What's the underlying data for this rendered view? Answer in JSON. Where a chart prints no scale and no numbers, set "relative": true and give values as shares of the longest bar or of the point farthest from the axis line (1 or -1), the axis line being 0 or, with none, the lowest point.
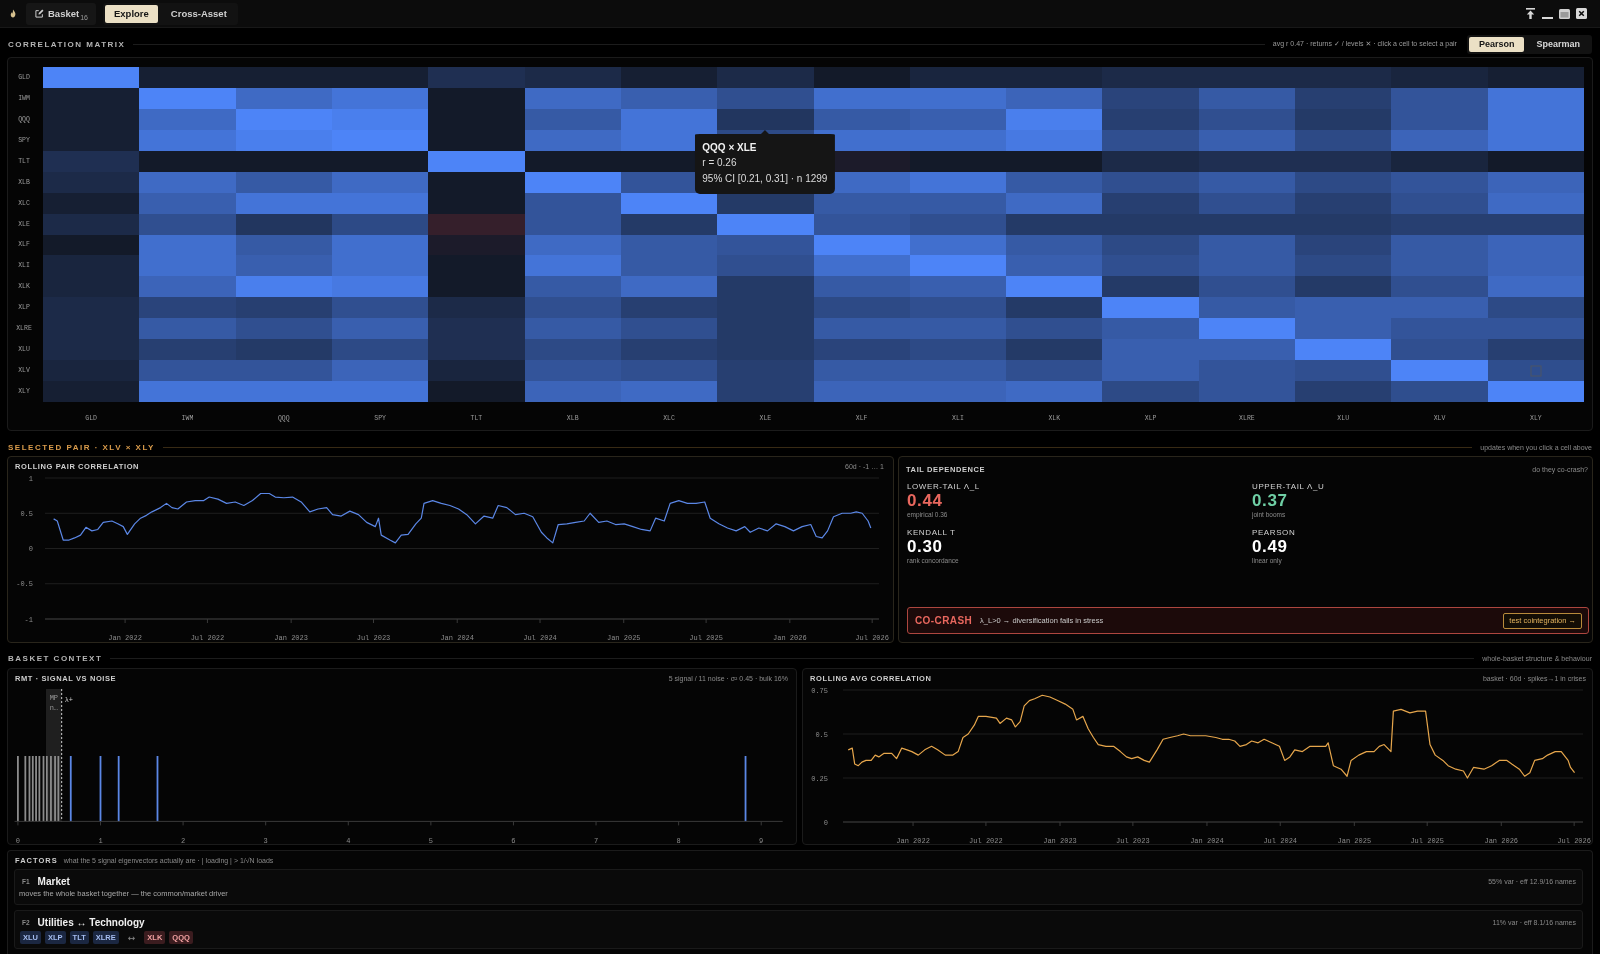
{
  "app_bar": {
    "basket_button": {
      "label": "Basket",
      "count": "16"
    },
    "tabs": [
      {
        "label": "Explore",
        "selected": true
      },
      {
        "label": "Cross-Asset",
        "selected": false
      }
    ]
  },
  "correlation": {
    "title": "CORRELATION MATRIX",
    "summary": "avg r 0.47 · returns ✓ / levels ✕ · click a cell to select a pair",
    "methods": [
      {
        "label": "Pearson",
        "selected": true
      },
      {
        "label": "Spearman",
        "selected": false
      }
    ],
    "matrix": {
      "row_labels": [
        "GLD",
        "IWM",
        "QQQ",
        "SPY",
        "TLT",
        "XLB",
        "XLC",
        "XLE",
        "XLF",
        "XLI",
        "XLK",
        "XLP",
        "XLRE",
        "XLU",
        "XLV",
        "XLY"
      ],
      "column_labels": [
        "GLD",
        "IWM",
        "QQQ",
        "SPY",
        "TLT",
        "XLB",
        "XLC",
        "XLE",
        "XLF",
        "XLI",
        "XLK",
        "XLP",
        "XLRE",
        "XLU",
        "XLV",
        "XLY"
      ]
    },
    "tooltip": {
      "title": "QQQ × XLE",
      "lines": [
        "r = 0.26",
        "95% CI [0.21, 0.31] · n 1299"
      ]
    }
  },
  "selected_pair": {
    "title": "SELECTED PAIR · XLV × XLY",
    "note": "updates when you click a cell above",
    "rolling": {
      "title": "ROLLING PAIR CORRELATION",
      "note": "60d · -1 … 1",
      "chart_data": {
        "type": "line",
        "x": [
          "2021-07-28",
          "2021-08-05",
          "2021-08-18",
          "2021-08-31",
          "2021-09-12",
          "2021-09-25",
          "2021-10-07",
          "2021-10-20",
          "2021-11-02",
          "2021-11-14",
          "2021-12-03",
          "2021-12-16",
          "2021-12-28",
          "2022-01-06",
          "2022-01-22",
          "2022-02-04",
          "2022-02-17",
          "2022-03-01",
          "2022-03-20",
          "2022-04-02",
          "2022-04-14",
          "2022-04-27",
          "2022-05-16",
          "2022-06-04",
          "2022-06-23",
          "2022-07-05",
          "2022-07-24",
          "2022-08-12",
          "2022-08-31",
          "2022-09-19",
          "2022-10-08",
          "2022-10-26",
          "2022-11-14",
          "2022-11-27",
          "2022-12-16",
          "2023-01-04",
          "2023-01-23",
          "2023-02-11",
          "2023-03-01",
          "2023-03-20",
          "2023-04-02",
          "2023-04-21",
          "2023-05-10",
          "2023-05-29",
          "2023-06-16",
          "2023-07-05",
          "2023-07-12",
          "2023-07-18",
          "2023-08-06",
          "2023-08-18",
          "2023-08-31",
          "2023-09-15",
          "2023-10-02",
          "2023-10-14",
          "2023-10-20",
          "2023-11-08",
          "2023-11-27",
          "2023-12-16",
          "2024-01-04",
          "2024-01-22",
          "2024-02-10",
          "2024-02-29",
          "2024-03-19",
          "2024-03-31",
          "2024-04-19",
          "2024-05-08",
          "2024-05-27",
          "2024-06-15",
          "2024-07-04",
          "2024-07-16",
          "2024-07-29",
          "2024-08-10",
          "2024-08-29",
          "2024-09-17",
          "2024-10-06",
          "2024-10-19",
          "2024-11-07",
          "2024-11-25",
          "2024-12-14",
          "2025-01-02",
          "2025-01-21",
          "2025-02-09",
          "2025-02-28",
          "2025-03-12",
          "2025-03-31",
          "2025-04-13",
          "2025-05-02",
          "2025-05-21",
          "2025-06-09",
          "2025-06-28",
          "2025-07-10",
          "2025-07-29",
          "2025-08-17",
          "2025-09-05",
          "2025-09-24",
          "2025-10-06",
          "2025-10-25",
          "2025-11-13",
          "2025-12-02",
          "2025-12-21",
          "2026-01-09",
          "2026-01-28",
          "2026-02-16",
          "2026-02-28",
          "2026-03-13",
          "2026-03-25",
          "2026-04-07",
          "2026-04-26",
          "2026-05-15",
          "2026-05-27",
          "2026-06-09",
          "2026-06-22",
          "2026-06-28"
        ],
        "values": [
          0.42,
          0.39,
          0.12,
          0.12,
          0.15,
          0.19,
          0.3,
          0.25,
          0.27,
          0.37,
          0.39,
          0.35,
          0.31,
          0.2,
          0.35,
          0.43,
          0.47,
          0.52,
          0.58,
          0.64,
          0.58,
          0.56,
          0.66,
          0.68,
          0.68,
          0.73,
          0.7,
          0.64,
          0.66,
          0.61,
          0.68,
          0.78,
          0.78,
          0.73,
          0.72,
          0.73,
          0.66,
          0.52,
          0.56,
          0.58,
          0.48,
          0.46,
          0.53,
          0.48,
          0.37,
          0.31,
          0.43,
          0.19,
          0.12,
          0.08,
          0.19,
          0.2,
          0.35,
          0.43,
          0.64,
          0.68,
          0.64,
          0.61,
          0.56,
          0.48,
          0.35,
          0.46,
          0.43,
          0.61,
          0.58,
          0.48,
          0.5,
          0.45,
          0.23,
          0.15,
          0.08,
          0.34,
          0.35,
          0.37,
          0.39,
          0.5,
          0.37,
          0.39,
          0.34,
          0.35,
          0.31,
          0.27,
          0.25,
          0.43,
          0.39,
          0.64,
          0.68,
          0.64,
          0.64,
          0.66,
          0.43,
          0.35,
          0.29,
          0.25,
          0.31,
          0.23,
          0.29,
          0.25,
          0.35,
          0.31,
          0.25,
          0.31,
          0.34,
          0.17,
          0.15,
          0.25,
          0.45,
          0.5,
          0.5,
          0.52,
          0.5,
          0.39,
          0.29
        ],
        "color": "#5b87e6",
        "xlim": [
          "2021-07-09",
          "2026-07-16"
        ],
        "ylim": [
          -1,
          1
        ],
        "yticks": [
          -1,
          -0.5,
          0,
          0.5,
          1
        ],
        "xticks": [
          {
            "value": "2022-01-01",
            "label": "Jan 2022"
          },
          {
            "value": "2022-07-01",
            "label": "Jul 2022"
          },
          {
            "value": "2023-01-01",
            "label": "Jan 2023"
          },
          {
            "value": "2023-07-01",
            "label": "Jul 2023"
          },
          {
            "value": "2024-01-01",
            "label": "Jan 2024"
          },
          {
            "value": "2024-07-01",
            "label": "Jul 2024"
          },
          {
            "value": "2025-01-01",
            "label": "Jan 2025"
          },
          {
            "value": "2025-07-01",
            "label": "Jul 2025"
          },
          {
            "value": "2026-01-01",
            "label": "Jan 2026"
          },
          {
            "value": "2026-07-01",
            "label": "Jul 2026"
          }
        ],
        "grid": true
      }
    },
    "tail": {
      "title": "TAIL DEPENDENCE",
      "note": "do they co-crash?",
      "stats": [
        {
          "label": "LOWER-TAIL Λ_L",
          "value": "0.44",
          "note": "empirical 0.36",
          "color": "#e8675e"
        },
        {
          "label": "UPPER-TAIL Λ_U",
          "value": "0.37",
          "note": "joint booms",
          "color": "#6fcfa5"
        },
        {
          "label": "KENDALL T",
          "value": "0.30",
          "note": "rank concordance",
          "color": "#ffffff"
        },
        {
          "label": "PEARSON",
          "value": "0.49",
          "note": "linear only",
          "color": "#ffffff"
        }
      ],
      "alert": {
        "title": "CO-CRASH",
        "message": "λ_L>0 → diversification fails in stress",
        "action": "test cointegration →"
      }
    }
  },
  "basket_context": {
    "title": "BASKET CONTEXT",
    "note": "whole-basket structure & behaviour",
    "rmt": {
      "title": "RMT · SIGNAL VS NOISE",
      "note": "5 signal / 11 noise · σ² 0.45 · bulk 16%",
      "chart_data": {
        "type": "bar",
        "relative": true,
        "tick_labels": "x",
        "x": [
          0,
          0.09,
          0.14,
          0.18,
          0.22,
          0.26,
          0.31,
          0.35,
          0.4,
          0.45,
          0.49,
          0.64,
          1.0,
          1.22,
          1.69,
          8.81
        ],
        "values": [
          1,
          1,
          1,
          1,
          1,
          1,
          1,
          1,
          1,
          1,
          1,
          1,
          1,
          1,
          1,
          1
        ],
        "colors": [
          "#8c8c8c",
          "#8c8c8c",
          "#8c8c8c",
          "#8c8c8c",
          "#8c8c8c",
          "#8c8c8c",
          "#8c8c8c",
          "#8c8c8c",
          "#8c8c8c",
          "#8c8c8c",
          "#8c8c8c",
          "#5b87e6",
          "#5b87e6",
          "#5b87e6",
          "#5b87e6",
          "#5b87e6"
        ],
        "xlim": [
          -0.04,
          9.26
        ],
        "xticks": [
          0,
          1,
          2,
          3,
          4,
          5,
          6,
          7,
          8,
          9
        ],
        "bands": [
          {
            "axis": "x",
            "from": 0.34,
            "to": 0.53,
            "label": "MP n…",
            "color": "#1f1f1f"
          }
        ],
        "ref_lines": [
          {
            "axis": "x",
            "value": 0.53,
            "label": "λ+",
            "color": "#cfcfcf",
            "line_style": "dashed"
          }
        ]
      }
    },
    "rolling_avg": {
      "title": "ROLLING AVG CORRELATION",
      "note": "basket · 60d · spikes→1 in crises",
      "chart_data": {
        "type": "line",
        "x": [
          "2021-07-24",
          "2021-08-03",
          "2021-08-09",
          "2021-08-18",
          "2021-08-27",
          "2021-09-06",
          "2021-09-19",
          "2021-09-29",
          "2021-10-08",
          "2021-10-21",
          "2021-11-09",
          "2021-11-21",
          "2021-12-04",
          "2021-12-17",
          "2021-12-29",
          "2022-01-14",
          "2022-01-30",
          "2022-02-16",
          "2022-03-03",
          "2022-03-22",
          "2022-04-10",
          "2022-04-23",
          "2022-05-05",
          "2022-05-18",
          "2022-06-02",
          "2022-06-12",
          "2022-07-01",
          "2022-07-27",
          "2022-08-05",
          "2022-08-21",
          "2022-09-03",
          "2022-09-12",
          "2022-09-24",
          "2022-10-04",
          "2022-10-17",
          "2022-10-30",
          "2022-11-18",
          "2022-12-07",
          "2022-12-26",
          "2023-01-14",
          "2023-02-02",
          "2023-02-11",
          "2023-02-27",
          "2023-03-12",
          "2023-03-25",
          "2023-04-06",
          "2023-04-25",
          "2023-05-14",
          "2023-05-31",
          "2023-06-15",
          "2023-06-28",
          "2023-07-13",
          "2023-07-29",
          "2023-08-11",
          "2023-08-30",
          "2023-09-14",
          "2023-10-01",
          "2023-10-20",
          "2023-11-04",
          "2023-11-21",
          "2023-12-10",
          "2023-12-29",
          "2024-01-23",
          "2024-02-08",
          "2024-02-24",
          "2024-03-10",
          "2024-03-23",
          "2024-04-08",
          "2024-04-21",
          "2024-05-07",
          "2024-05-22",
          "2024-06-10",
          "2024-06-29",
          "2024-07-12",
          "2024-07-25",
          "2024-08-06",
          "2024-08-25",
          "2024-09-13",
          "2024-10-03",
          "2024-10-22",
          "2024-10-28",
          "2024-11-10",
          "2024-11-29",
          "2024-12-14",
          "2024-12-24",
          "2025-01-12",
          "2025-01-31",
          "2025-02-19",
          "2025-03-04",
          "2025-03-16",
          "2025-04-02",
          "2025-04-08",
          "2025-04-27",
          "2025-05-19",
          "2025-06-07",
          "2025-06-27",
          "2025-07-08",
          "2025-07-21",
          "2025-08-09",
          "2025-08-22",
          "2025-09-10",
          "2025-09-29",
          "2025-10-09",
          "2025-10-24",
          "2025-11-19",
          "2025-12-08",
          "2025-12-27",
          "2026-01-15",
          "2026-01-27",
          "2026-02-15",
          "2026-02-28",
          "2026-03-13",
          "2026-03-25",
          "2026-04-13",
          "2026-04-26",
          "2026-05-15",
          "2026-05-30",
          "2026-06-16",
          "2026-06-22",
          "2026-07-02"
        ],
        "values": [
          0.41,
          0.42,
          0.33,
          0.32,
          0.34,
          0.35,
          0.35,
          0.38,
          0.37,
          0.39,
          0.39,
          0.36,
          0.42,
          0.41,
          0.4,
          0.38,
          0.41,
          0.43,
          0.41,
          0.38,
          0.38,
          0.4,
          0.48,
          0.5,
          0.55,
          0.6,
          0.6,
          0.59,
          0.56,
          0.59,
          0.58,
          0.54,
          0.57,
          0.66,
          0.69,
          0.7,
          0.72,
          0.71,
          0.69,
          0.67,
          0.64,
          0.58,
          0.6,
          0.53,
          0.48,
          0.44,
          0.43,
          0.43,
          0.4,
          0.37,
          0.36,
          0.37,
          0.35,
          0.34,
          0.41,
          0.47,
          0.48,
          0.49,
          0.5,
          0.49,
          0.49,
          0.49,
          0.48,
          0.47,
          0.47,
          0.46,
          0.43,
          0.44,
          0.46,
          0.45,
          0.47,
          0.45,
          0.43,
          0.35,
          0.37,
          0.41,
          0.4,
          0.43,
          0.43,
          0.43,
          0.45,
          0.32,
          0.3,
          0.26,
          0.35,
          0.38,
          0.4,
          0.4,
          0.43,
          0.44,
          0.4,
          0.63,
          0.64,
          0.62,
          0.63,
          0.63,
          0.44,
          0.38,
          0.35,
          0.32,
          0.3,
          0.29,
          0.25,
          0.31,
          0.3,
          0.32,
          0.35,
          0.35,
          0.33,
          0.3,
          0.26,
          0.28,
          0.35,
          0.36,
          0.38,
          0.4,
          0.4,
          0.35,
          0.31,
          0.28
        ],
        "color": "#e6a64c",
        "xlim": [
          "2021-07-11",
          "2026-07-23"
        ],
        "ylim": [
          0,
          0.75
        ],
        "yticks": [
          0,
          0.25,
          0.5,
          0.75
        ],
        "xticks": [
          {
            "value": "2022-01-01",
            "label": "Jan 2022"
          },
          {
            "value": "2022-07-01",
            "label": "Jul 2022"
          },
          {
            "value": "2023-01-01",
            "label": "Jan 2023"
          },
          {
            "value": "2023-07-01",
            "label": "Jul 2023"
          },
          {
            "value": "2024-01-01",
            "label": "Jan 2024"
          },
          {
            "value": "2024-07-01",
            "label": "Jul 2024"
          },
          {
            "value": "2025-01-01",
            "label": "Jan 2025"
          },
          {
            "value": "2025-07-01",
            "label": "Jul 2025"
          },
          {
            "value": "2026-01-01",
            "label": "Jan 2026"
          },
          {
            "value": "2026-07-01",
            "label": "Jul 2026"
          }
        ],
        "grid": true
      }
    }
  },
  "factors": {
    "title": "FACTORS",
    "subtitle": "what the 5 signal eigenvectors actually are · | loading | > 1/√N loads",
    "items": [
      {
        "tag": "F1",
        "name": "Market",
        "stats": "55% var · eff 12.9/16 names",
        "description": "moves the whole basket together — the common/market driver"
      },
      {
        "tag": "F2",
        "name": "Utilities ↔ Technology",
        "stats": "11% var · eff 8.1/16 names",
        "loadings": {
          "positive": [
            "XLU",
            "XLP",
            "TLT",
            "XLRE"
          ],
          "separator": "↔",
          "negative": [
            "XLK",
            "QQQ"
          ]
        }
      }
    ]
  }
}
